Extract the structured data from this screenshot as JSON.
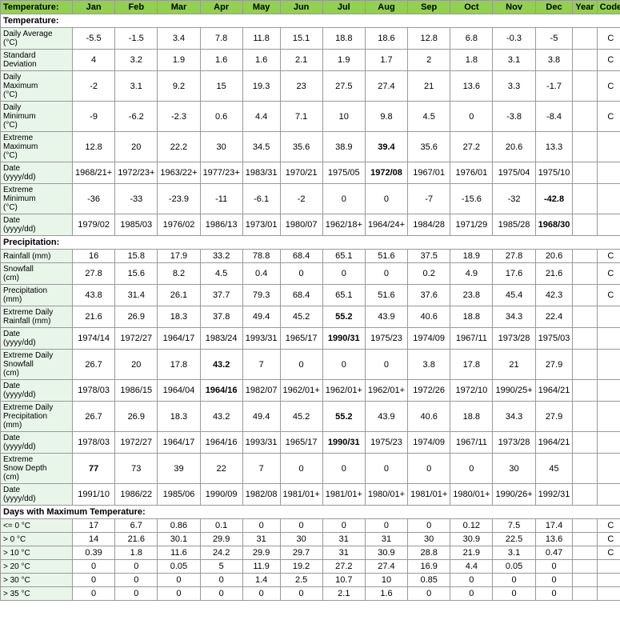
{
  "headers": {
    "label": "Temperature:",
    "months": [
      "Jan",
      "Feb",
      "Mar",
      "Apr",
      "May",
      "Jun",
      "Jul",
      "Aug",
      "Sep",
      "Oct",
      "Nov",
      "Dec",
      "Year",
      "Code"
    ]
  },
  "sections": [
    {
      "type": "section-header",
      "label": "Temperature:"
    },
    {
      "label": "Daily Average\n(°C)",
      "values": [
        "-5.5",
        "-1.5",
        "3.4",
        "7.8",
        "11.8",
        "15.1",
        "18.8",
        "18.6",
        "12.8",
        "6.8",
        "-0.3",
        "-5",
        "",
        "C"
      ],
      "bold": []
    },
    {
      "label": "Standard\nDeviation",
      "values": [
        "4",
        "3.2",
        "1.9",
        "1.6",
        "1.6",
        "2.1",
        "1.9",
        "1.7",
        "2",
        "1.8",
        "3.1",
        "3.8",
        "",
        "C"
      ],
      "bold": []
    },
    {
      "label": "Daily\nMaximum\n(°C)",
      "values": [
        "-2",
        "3.1",
        "9.2",
        "15",
        "19.3",
        "23",
        "27.5",
        "27.4",
        "21",
        "13.6",
        "3.3",
        "-1.7",
        "",
        "C"
      ],
      "bold": []
    },
    {
      "label": "Daily\nMinimum\n(°C)",
      "values": [
        "-9",
        "-6.2",
        "-2.3",
        "0.6",
        "4.4",
        "7.1",
        "10",
        "9.8",
        "4.5",
        "0",
        "-3.8",
        "-8.4",
        "",
        "C"
      ],
      "bold": []
    },
    {
      "label": "Extreme\nMaximum\n(°C)",
      "values": [
        "12.8",
        "20",
        "22.2",
        "30",
        "34.5",
        "35.6",
        "38.9",
        "39.4",
        "35.6",
        "27.2",
        "20.6",
        "13.3",
        "",
        ""
      ],
      "bold": [
        7
      ]
    },
    {
      "label": "Date\n(yyyy/dd)",
      "values": [
        "1968/21+",
        "1972/23+",
        "1963/22+",
        "1977/23+",
        "1983/31",
        "1970/21",
        "1975/05",
        "1972/08",
        "1967/01",
        "1976/01",
        "1975/04",
        "1975/10",
        "",
        ""
      ],
      "bold": [
        7
      ]
    },
    {
      "label": "Extreme\nMinimum\n(°C)",
      "values": [
        "-36",
        "-33",
        "-23.9",
        "-11",
        "-6.1",
        "-2",
        "0",
        "0",
        "-7",
        "-15.6",
        "-32",
        "-42.8",
        "",
        ""
      ],
      "bold": [
        11
      ]
    },
    {
      "label": "Date\n(yyyy/dd)",
      "values": [
        "1979/02",
        "1985/03",
        "1976/02",
        "1986/13",
        "1973/01",
        "1980/07",
        "1962/18+",
        "1964/24+",
        "1984/28",
        "1971/29",
        "1985/28",
        "1968/30",
        "",
        ""
      ],
      "bold": [
        11
      ]
    },
    {
      "type": "section-header",
      "label": "Precipitation:"
    },
    {
      "label": "Rainfall (mm)",
      "values": [
        "16",
        "15.8",
        "17.9",
        "33.2",
        "78.8",
        "68.4",
        "65.1",
        "51.6",
        "37.5",
        "18.9",
        "27.8",
        "20.6",
        "",
        "C"
      ],
      "bold": []
    },
    {
      "label": "Snowfall\n(cm)",
      "values": [
        "27.8",
        "15.6",
        "8.2",
        "4.5",
        "0.4",
        "0",
        "0",
        "0",
        "0.2",
        "4.9",
        "17.6",
        "21.6",
        "",
        "C"
      ],
      "bold": []
    },
    {
      "label": "Precipitation\n(mm)",
      "values": [
        "43.8",
        "31.4",
        "26.1",
        "37.7",
        "79.3",
        "68.4",
        "65.1",
        "51.6",
        "37.6",
        "23.8",
        "45.4",
        "42.3",
        "",
        "C"
      ],
      "bold": []
    },
    {
      "label": "Extreme Daily\nRainfall (mm)",
      "values": [
        "21.6",
        "26.9",
        "18.3",
        "37.8",
        "49.4",
        "45.2",
        "55.2",
        "43.9",
        "40.6",
        "18.8",
        "34.3",
        "22.4",
        "",
        ""
      ],
      "bold": [
        6
      ]
    },
    {
      "label": "Date\n(yyyy/dd)",
      "values": [
        "1974/14",
        "1972/27",
        "1964/17",
        "1983/24",
        "1993/31",
        "1965/17",
        "1990/31",
        "1975/23",
        "1974/09",
        "1967/11",
        "1973/28",
        "1975/03",
        "",
        ""
      ],
      "bold": [
        6
      ]
    },
    {
      "label": "Extreme Daily\nSnowfall\n(cm)",
      "values": [
        "26.7",
        "20",
        "17.8",
        "43.2",
        "7",
        "0",
        "0",
        "0",
        "3.8",
        "17.8",
        "21",
        "27.9",
        "",
        ""
      ],
      "bold": [
        3
      ]
    },
    {
      "label": "Date\n(yyyy/dd)",
      "values": [
        "1978/03",
        "1986/15",
        "1964/04",
        "1964/16",
        "1982/07",
        "1962/01+",
        "1962/01+",
        "1962/01+",
        "1972/26",
        "1972/10",
        "1990/25+",
        "1964/21",
        "",
        ""
      ],
      "bold": [
        3
      ]
    },
    {
      "label": "Extreme Daily\nPrecipitation\n(mm)",
      "values": [
        "26.7",
        "26.9",
        "18.3",
        "43.2",
        "49.4",
        "45.2",
        "55.2",
        "43.9",
        "40.6",
        "18.8",
        "34.3",
        "27.9",
        "",
        ""
      ],
      "bold": [
        6
      ]
    },
    {
      "label": "Date\n(yyyy/dd)",
      "values": [
        "1978/03",
        "1972/27",
        "1964/17",
        "1964/16",
        "1993/31",
        "1965/17",
        "1990/31",
        "1975/23",
        "1974/09",
        "1967/11",
        "1973/28",
        "1964/21",
        "",
        ""
      ],
      "bold": [
        6
      ]
    },
    {
      "label": "Extreme\nSnow Depth\n(cm)",
      "values": [
        "77",
        "73",
        "39",
        "22",
        "7",
        "0",
        "0",
        "0",
        "0",
        "0",
        "30",
        "45",
        "",
        ""
      ],
      "bold": [
        0
      ]
    },
    {
      "label": "Date\n(yyyy/dd)",
      "values": [
        "1991/10",
        "1986/22",
        "1985/06",
        "1990/09",
        "1982/08",
        "1981/01+",
        "1981/01+",
        "1980/01+",
        "1981/01+",
        "1980/01+",
        "1990/26+",
        "1992/31",
        "",
        ""
      ],
      "bold": []
    },
    {
      "type": "section-header",
      "label": "Days with Maximum Temperature:"
    },
    {
      "label": "<= 0 °C",
      "values": [
        "17",
        "6.7",
        "0.86",
        "0.1",
        "0",
        "0",
        "0",
        "0",
        "0",
        "0.12",
        "7.5",
        "17.4",
        "",
        "C"
      ],
      "bold": []
    },
    {
      "label": "> 0 °C",
      "values": [
        "14",
        "21.6",
        "30.1",
        "29.9",
        "31",
        "30",
        "31",
        "31",
        "30",
        "30.9",
        "22.5",
        "13.6",
        "",
        "C"
      ],
      "bold": []
    },
    {
      "label": "> 10 °C",
      "values": [
        "0.39",
        "1.8",
        "11.6",
        "24.2",
        "29.9",
        "29.7",
        "31",
        "30.9",
        "28.8",
        "21.9",
        "3.1",
        "0.47",
        "",
        "C"
      ],
      "bold": []
    },
    {
      "label": "> 20 °C",
      "values": [
        "0",
        "0",
        "0.05",
        "5",
        "11.9",
        "19.2",
        "27.2",
        "27.4",
        "16.9",
        "4.4",
        "0.05",
        "0",
        "",
        ""
      ],
      "bold": []
    },
    {
      "label": "> 30 °C",
      "values": [
        "0",
        "0",
        "0",
        "0",
        "1.4",
        "2.5",
        "10.7",
        "10",
        "0.85",
        "0",
        "0",
        "0",
        "",
        ""
      ],
      "bold": []
    },
    {
      "label": "> 35 °C",
      "values": [
        "0",
        "0",
        "0",
        "0",
        "0",
        "0",
        "2.1",
        "1.6",
        "0",
        "0",
        "0",
        "0",
        "",
        ""
      ],
      "bold": []
    }
  ]
}
